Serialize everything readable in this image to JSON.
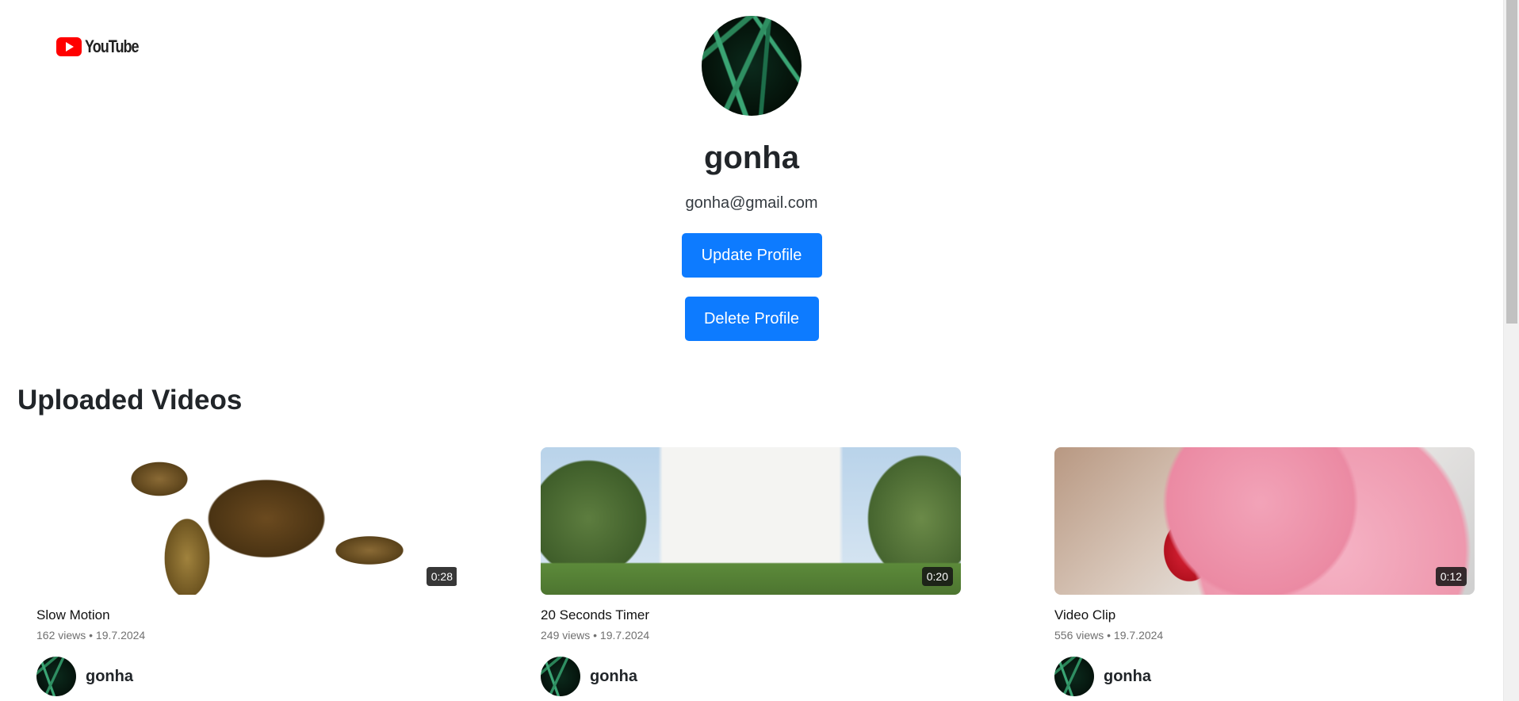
{
  "logo": {
    "text": "YouTube"
  },
  "profile": {
    "username": "gonha",
    "email": "gonha@gmail.com",
    "update_label": "Update Profile",
    "delete_label": "Delete Profile"
  },
  "section": {
    "title": "Uploaded Videos"
  },
  "videos": [
    {
      "title": "Slow Motion",
      "meta": "162 views • 19.7.2024",
      "duration": "0:28",
      "channel": "gonha"
    },
    {
      "title": "20 Seconds Timer",
      "meta": "249 views • 19.7.2024",
      "duration": "0:20",
      "channel": "gonha"
    },
    {
      "title": "Video Clip",
      "meta": "556 views • 19.7.2024",
      "duration": "0:12",
      "channel": "gonha"
    }
  ]
}
